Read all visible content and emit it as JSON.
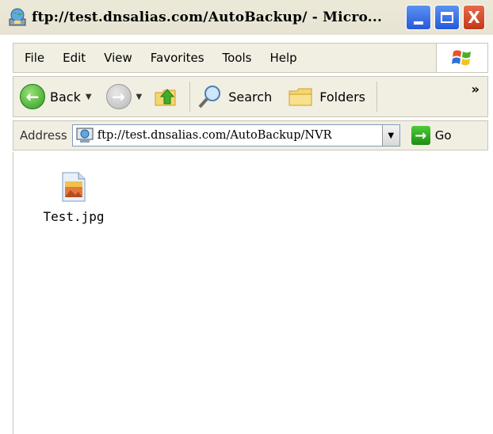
{
  "window": {
    "title": "ftp://test.dnsalias.com/AutoBackup/ - Micro...",
    "close_glyph": "X"
  },
  "menu": {
    "items": [
      "File",
      "Edit",
      "View",
      "Favorites",
      "Tools",
      "Help"
    ]
  },
  "toolbar": {
    "back_label": "Back",
    "search_label": "Search",
    "folders_label": "Folders",
    "more_glyph": "»"
  },
  "address": {
    "label": "Address",
    "value": "ftp://test.dnsalias.com/AutoBackup/NVR",
    "go_label": "Go"
  },
  "files": [
    {
      "name": "Test.jpg",
      "icon": "jpg-file-icon"
    }
  ],
  "colors": {
    "title_bar_bg": "#ece9d8",
    "close_button": "#c1391a",
    "caption_buttons": "#2659d7",
    "go_button": "#1e8d14"
  }
}
